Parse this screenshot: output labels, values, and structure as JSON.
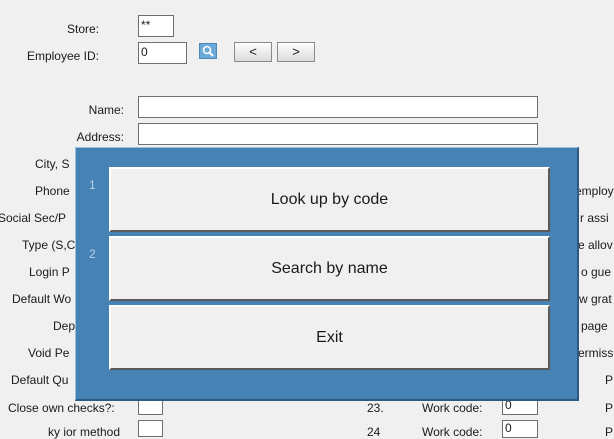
{
  "form": {
    "store_label": "Store:",
    "store_value": "**",
    "employee_id_label": "Employee ID:",
    "employee_id_value": "0",
    "prev_label": "<",
    "next_label": ">",
    "name_label": "Name:",
    "address_label": "Address:",
    "city_label": "City, S",
    "phone_label": "Phone",
    "ssn_label": "Social Sec/P",
    "type_label": "Type (S,C",
    "login_label": "Login P",
    "default_wo_label": "Default Wo",
    "dep_label": "Dep",
    "void_label": "Void Pe",
    "default_qu_label": "Default Qu",
    "close_checks_label": "Close own checks?:",
    "last_label": "ky   ior  method",
    "right_col": [
      "employ",
      "r assi",
      "e allov",
      "o  gue",
      "w grat",
      "page",
      "ermiss"
    ],
    "far_right": [
      "P",
      "P",
      "P"
    ],
    "num_23": "23.",
    "work_code_label": "Work code:",
    "work_code_value": "0",
    "num_24": "24",
    "work_code2_label": "Work code:",
    "work_code2_value": "0"
  },
  "dialog": {
    "options": [
      {
        "number": "1",
        "label": "Look up by code"
      },
      {
        "number": "2",
        "label": "Search by name"
      },
      {
        "number": "",
        "label": "Exit"
      }
    ]
  }
}
